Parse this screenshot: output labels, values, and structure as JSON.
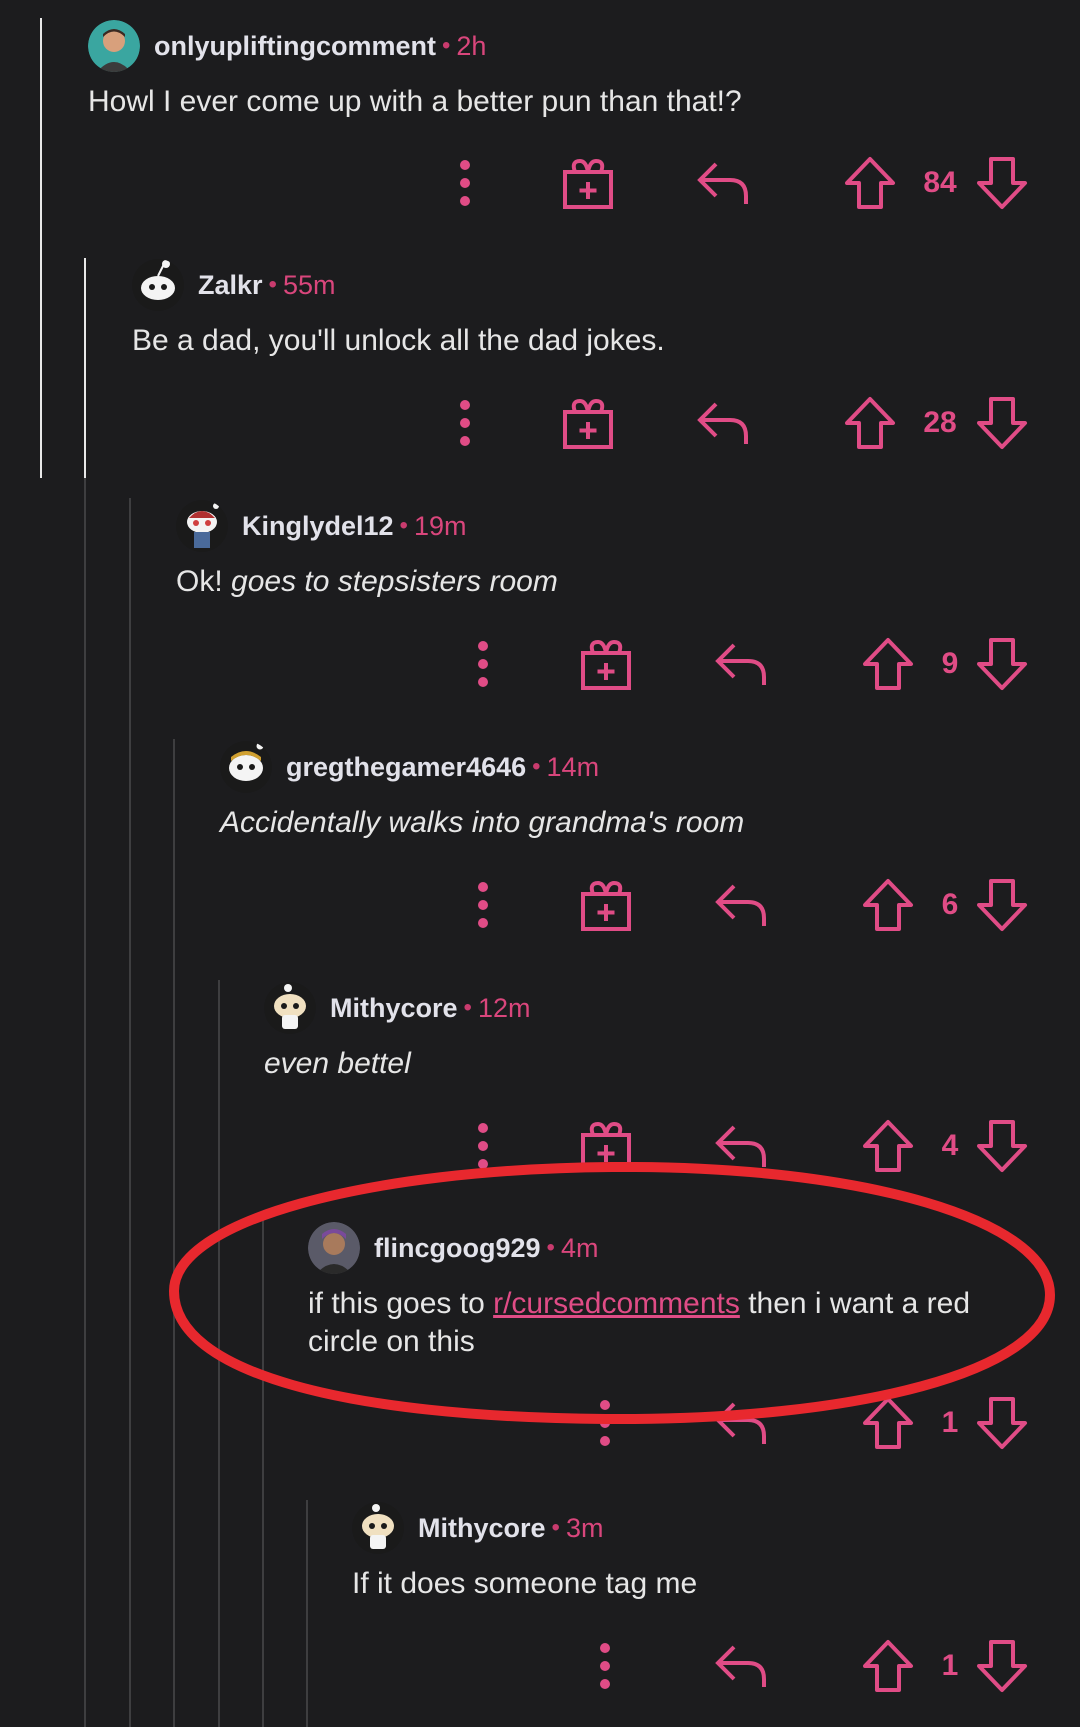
{
  "theme": {
    "background": "#1c1c1e",
    "accent": "#e04c86",
    "text": "#e6e6e6",
    "annotation": "#e8282e"
  },
  "comments": [
    {
      "username": "onlyupliftingcomment",
      "separator": "•",
      "time": "2h",
      "body": "Howl I ever come up with a better pun than that!?",
      "score": "84",
      "has_award": true,
      "avatar_icon": "user-photo-avatar"
    },
    {
      "username": "Zalkr",
      "separator": "•",
      "time": "55m",
      "body": "Be a dad, you'll unlock all the dad jokes.",
      "score": "28",
      "has_award": true,
      "avatar_icon": "snoo-avatar"
    },
    {
      "username": "Kinglydel12",
      "separator": "•",
      "time": "19m",
      "body_prefix": "Ok! ",
      "body_italic": "goes to stepsisters room",
      "score": "9",
      "has_award": true,
      "avatar_icon": "snoo-avatar"
    },
    {
      "username": "gregthegamer4646",
      "separator": "•",
      "time": "14m",
      "body_italic": "Accidentally walks into grandma's room",
      "score": "6",
      "has_award": true,
      "avatar_icon": "snoo-avatar"
    },
    {
      "username": "Mithycore",
      "separator": "•",
      "time": "12m",
      "body_italic": "even bettel",
      "score": "4",
      "has_award": true,
      "avatar_icon": "snoo-avatar"
    },
    {
      "username": "flincgoog929",
      "separator": "•",
      "time": "4m",
      "body_prefix": "if this goes to ",
      "body_link": "r/cursedcomments",
      "body_suffix": " then i want a red circle on this",
      "score": "1",
      "has_award": false,
      "avatar_icon": "user-photo-avatar"
    },
    {
      "username": "Mithycore",
      "separator": "•",
      "time": "3m",
      "body": "If it does someone tag me",
      "score": "1",
      "has_award": false,
      "avatar_icon": "snoo-avatar"
    }
  ]
}
